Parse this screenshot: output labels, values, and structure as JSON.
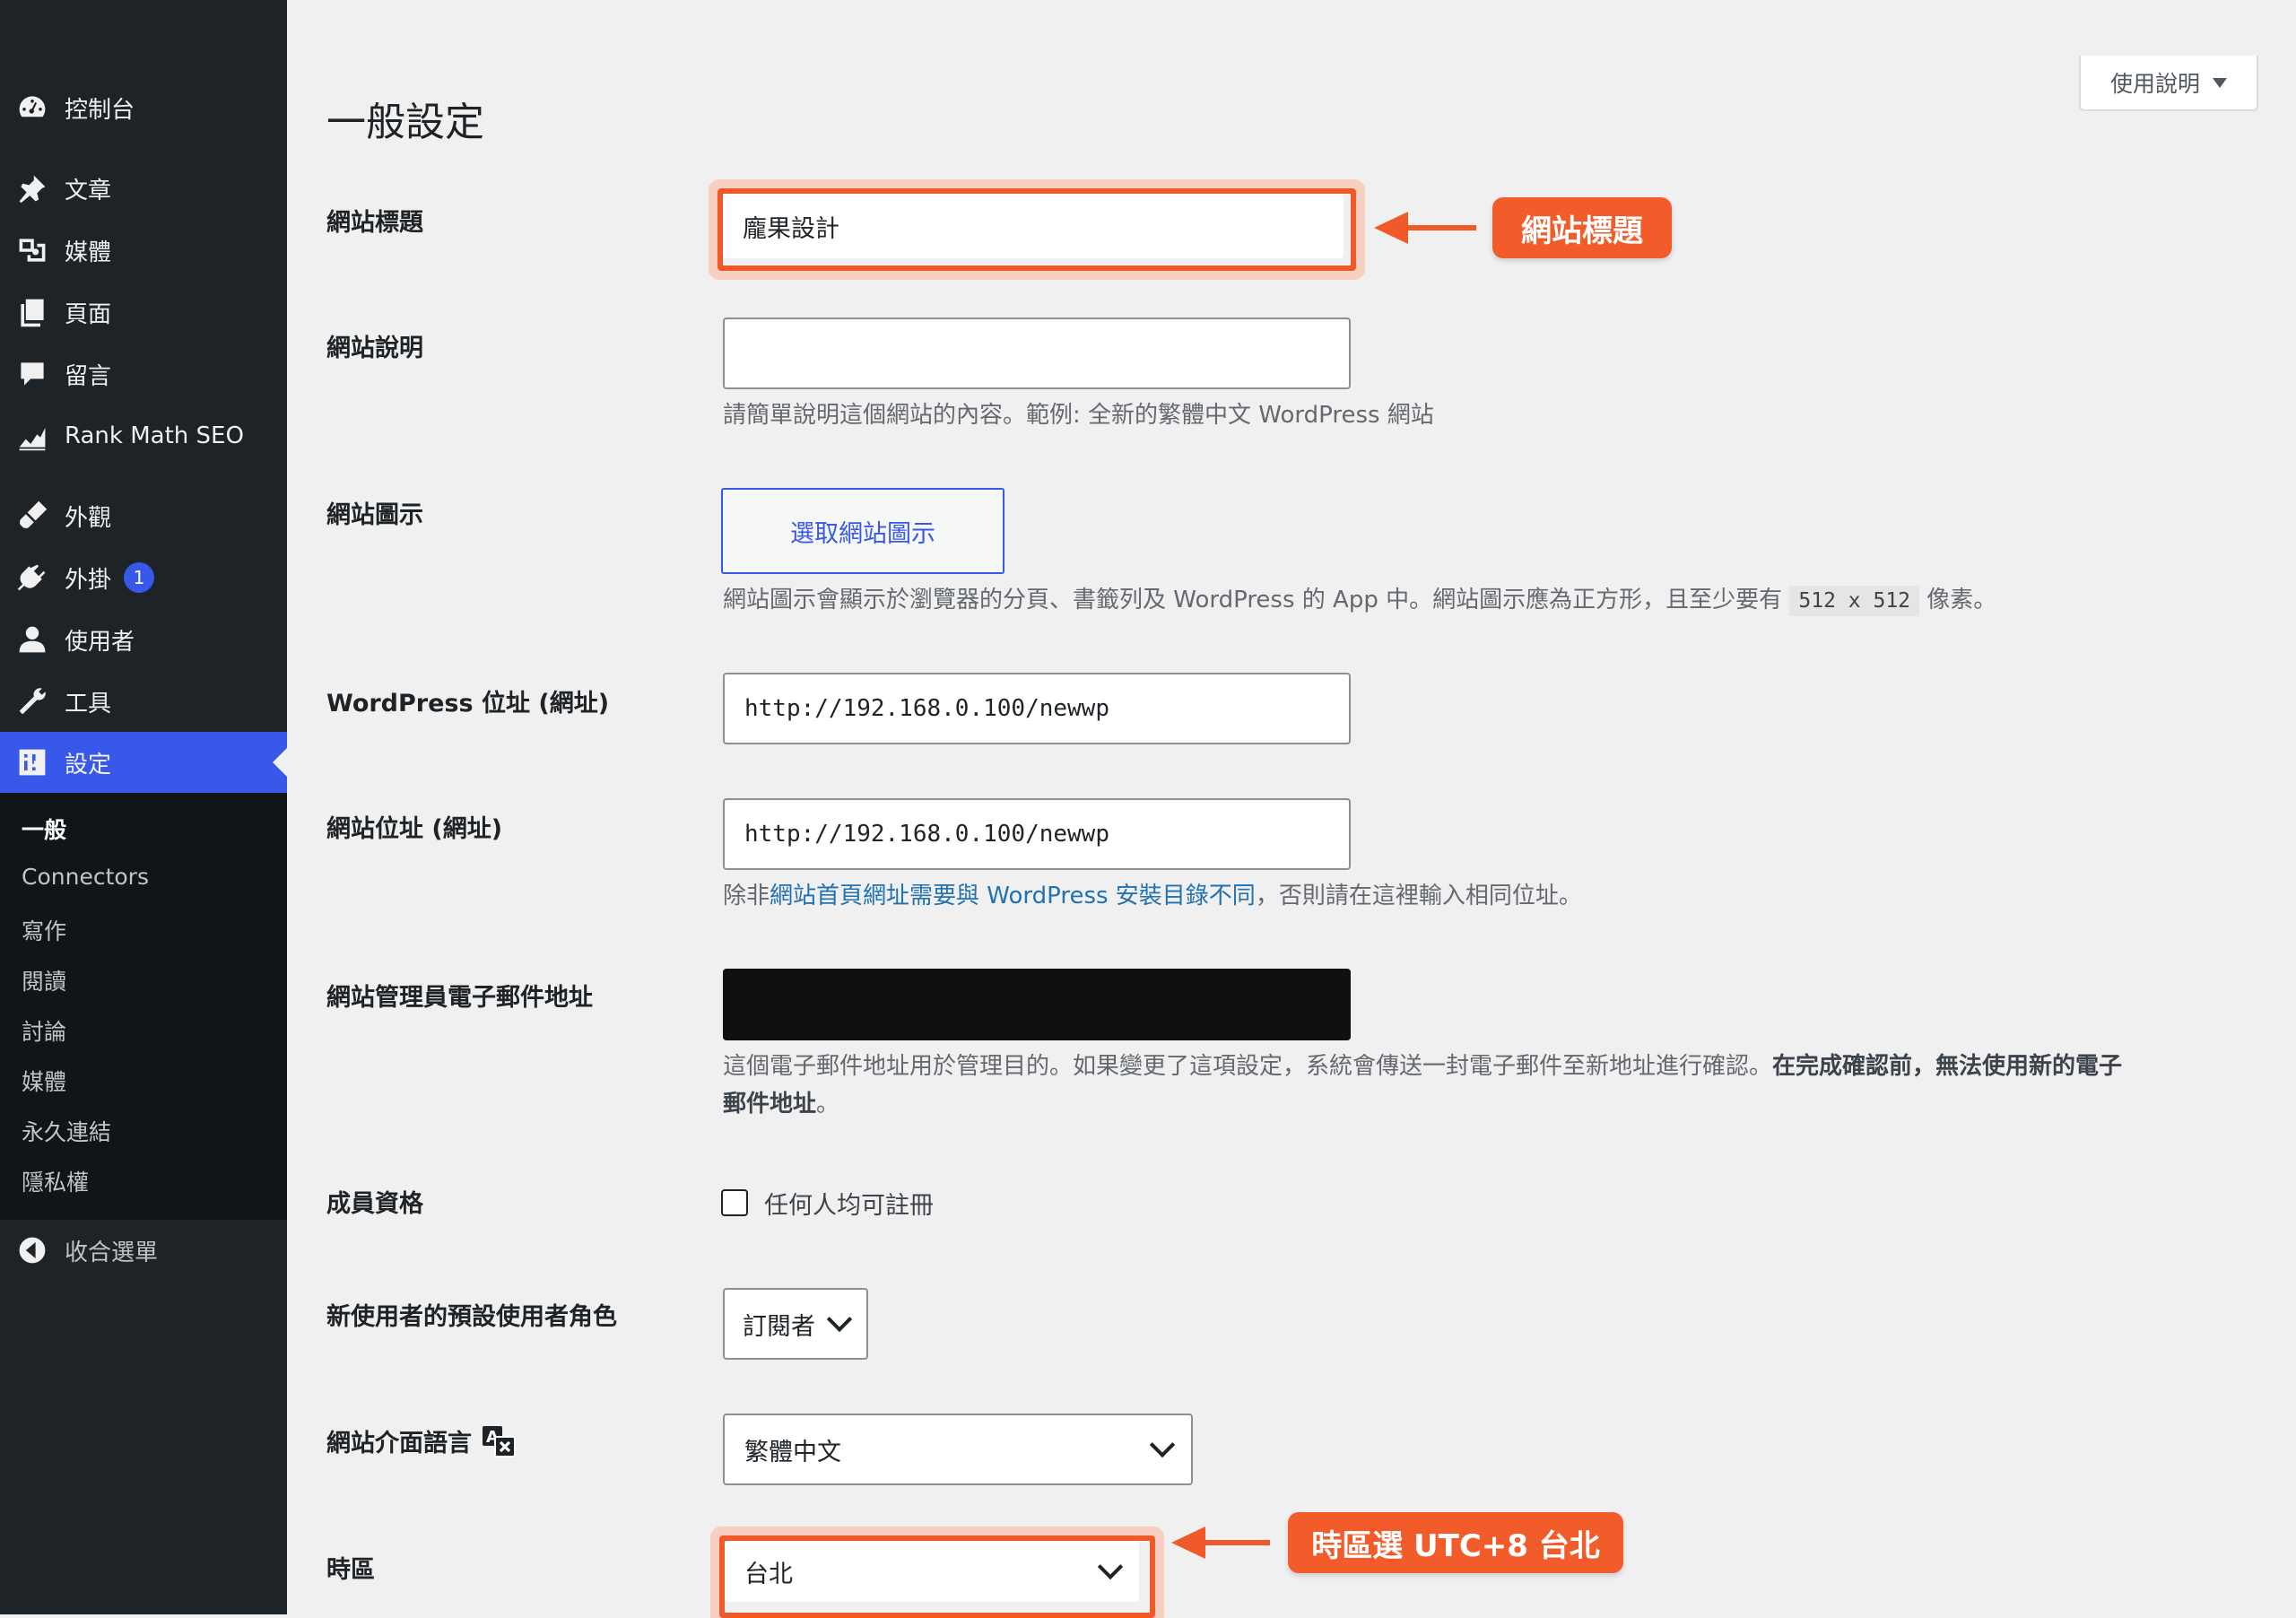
{
  "sidebar": {
    "items": [
      {
        "label": "控制台",
        "icon": "dashboard-icon"
      },
      {
        "label": "文章",
        "icon": "pin-icon"
      },
      {
        "label": "媒體",
        "icon": "media-icon"
      },
      {
        "label": "頁面",
        "icon": "pages-icon"
      },
      {
        "label": "留言",
        "icon": "comment-icon"
      },
      {
        "label": "Rank Math SEO",
        "icon": "rank-math-icon"
      },
      {
        "label": "外觀",
        "icon": "brush-icon"
      },
      {
        "label": "外掛",
        "icon": "plugin-icon",
        "badge": "1"
      },
      {
        "label": "使用者",
        "icon": "user-icon"
      },
      {
        "label": "工具",
        "icon": "wrench-icon"
      },
      {
        "label": "設定",
        "icon": "settings-icon",
        "active": true
      }
    ],
    "submenu": [
      "一般",
      "Connectors",
      "寫作",
      "閱讀",
      "討論",
      "媒體",
      "永久連結",
      "隱私權"
    ],
    "collapse_label": "收合選單"
  },
  "help_tab": "使用說明",
  "page_title": "一般設定",
  "fields": {
    "site_title": {
      "label": "網站標題",
      "value": "龐果設計"
    },
    "tagline": {
      "label": "網站說明",
      "value": "",
      "description": "請簡單說明這個網站的內容。範例: 全新的繁體中文 WordPress 網站"
    },
    "site_icon": {
      "label": "網站圖示",
      "button": "選取網站圖示",
      "description_before": "網站圖示會顯示於瀏覽器的分頁、書籤列及 WordPress 的 App 中。網站圖示應為正方形，且至少要有",
      "code": "512 x 512",
      "description_after": "像素。"
    },
    "wp_address": {
      "label": "WordPress 位址 (網址)",
      "value": "http://192.168.0.100/newwp"
    },
    "site_address": {
      "label": "網站位址 (網址)",
      "value": "http://192.168.0.100/newwp",
      "desc_before": "除非",
      "desc_link": "網站首頁網址需要與 WordPress 安裝目錄不同",
      "desc_after": "，否則請在這裡輸入相同位址。"
    },
    "admin_email": {
      "label": "網站管理員電子郵件地址",
      "desc_plain": "這個電子郵件地址用於管理目的。如果變更了這項設定，系統會傳送一封電子郵件至新地址進行確認。",
      "desc_bold_1": "在完成確認前，無法使用新的電子",
      "desc_bold_2": "郵件地址",
      "desc_end": "。"
    },
    "membership": {
      "label": "成員資格",
      "checkbox_label": "任何人均可註冊",
      "checked": false
    },
    "default_role": {
      "label": "新使用者的預設使用者角色",
      "value": "訂閱者"
    },
    "site_language": {
      "label": "網站介面語言",
      "value": "繁體中文",
      "icon": "translation-icon"
    },
    "timezone": {
      "label": "時區",
      "value": "台北"
    }
  },
  "annotations": {
    "site_title_callout": "網站標題",
    "timezone_callout": "時區選 UTC+8 台北",
    "color": "#f25c2a"
  },
  "colors": {
    "sidebar_bg": "#1d2327",
    "active_menu": "#3858e9",
    "page_bg": "#f0f0f1"
  }
}
